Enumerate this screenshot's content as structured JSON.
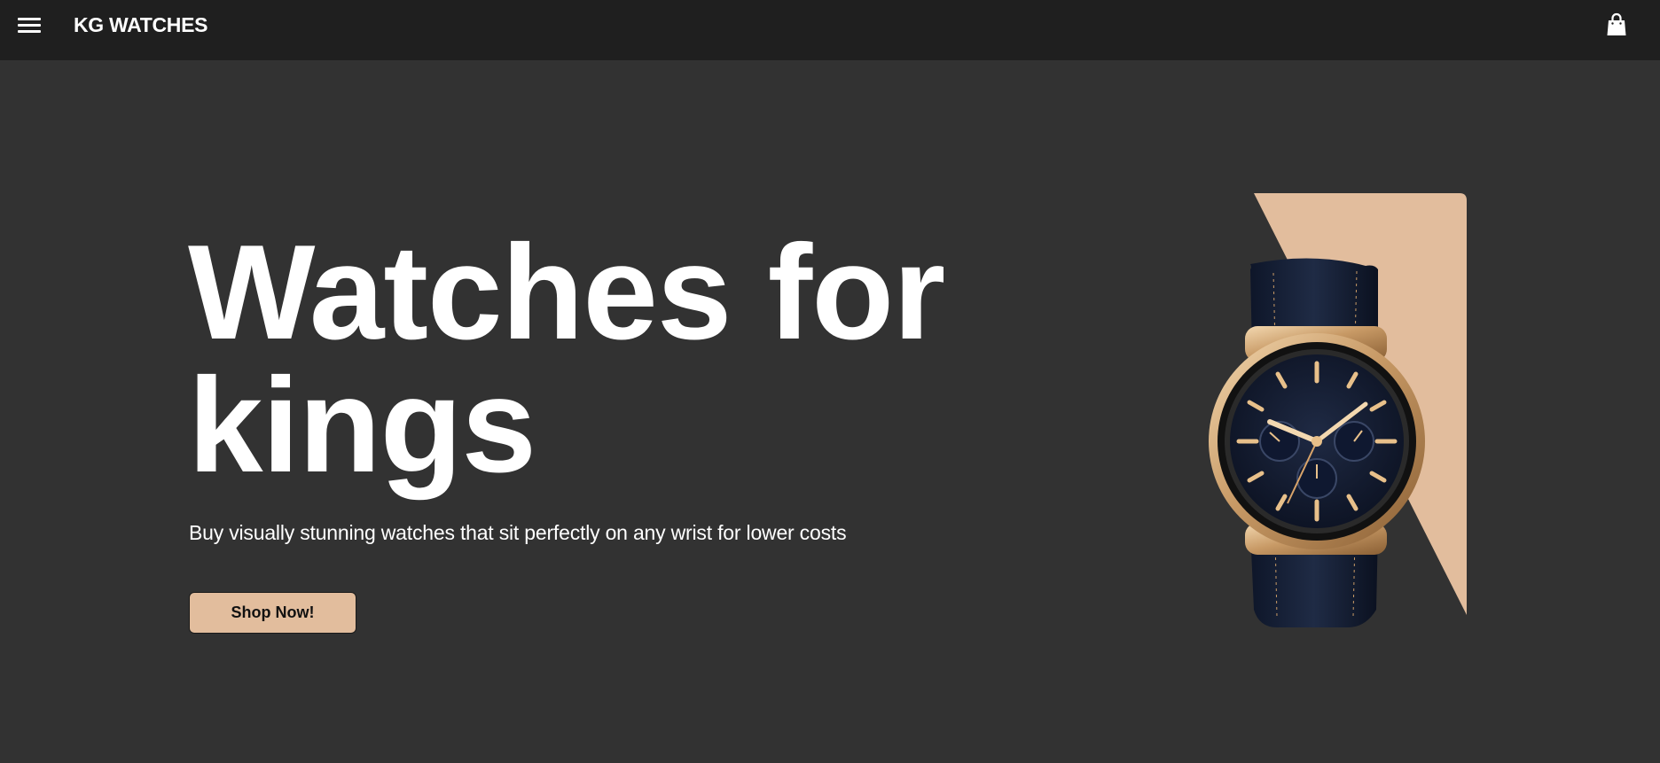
{
  "header": {
    "brand": "KG WATCHES",
    "menu_icon": "hamburger-menu-icon",
    "cart_icon": "shopping-bag-icon"
  },
  "hero": {
    "title_line1": "Watches for",
    "title_line2": "kings",
    "subtitle": "Buy visually stunning watches that sit perfectly on any wrist for lower costs",
    "cta_label": "Shop Now!",
    "image_alt": "Gold chronograph wristwatch with navy dial and leather strap"
  },
  "colors": {
    "page_background": "#323232",
    "header_background": "#1f1f1f",
    "accent": "#e2bd9d",
    "text": "#ffffff"
  }
}
